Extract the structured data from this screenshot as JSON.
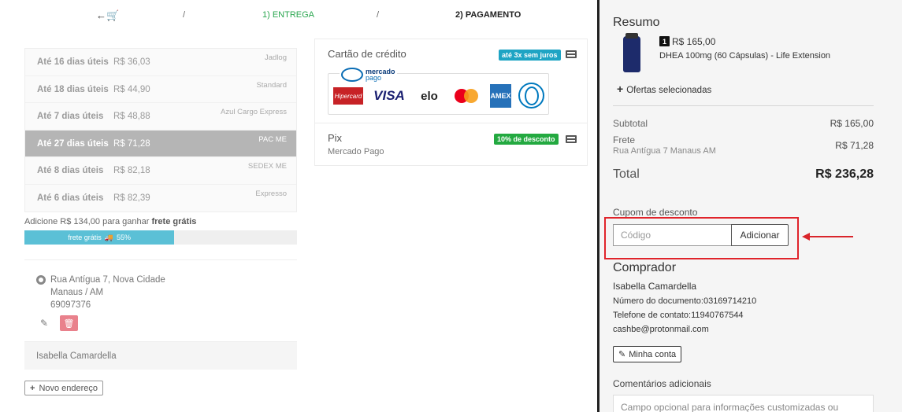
{
  "steps": {
    "back_icon": "arrow-cart-icon",
    "back_glyph": "←🛒",
    "separator": "/",
    "step1": "1) ENTREGA",
    "step2": "2) PAGAMENTO"
  },
  "shipping": {
    "options": [
      {
        "days": "Até 16 dias úteis",
        "price": "R$ 36,03",
        "carrier": "Jadlog",
        "selected": false
      },
      {
        "days": "Até 18 dias úteis",
        "price": "R$ 44,90",
        "carrier": "Standard",
        "selected": false
      },
      {
        "days": "Até 7 dias úteis",
        "price": "R$ 48,88",
        "carrier": "Azul Cargo Express",
        "selected": false
      },
      {
        "days": "Até 27 dias úteis",
        "price": "R$ 71,28",
        "carrier": "PAC ME",
        "selected": true
      },
      {
        "days": "Até 8 dias úteis",
        "price": "R$ 82,18",
        "carrier": "SEDEX ME",
        "selected": false
      },
      {
        "days": "Até 6 dias úteis",
        "price": "R$ 82,39",
        "carrier": "Expresso",
        "selected": false
      }
    ],
    "free_prefix": "Adicione R$ 134,00 para ganhar",
    "free_bold": "frete grátis",
    "progress_label": "frete grátis",
    "progress_percent_label": "55%",
    "progress_value": 0.55,
    "progress_color": "#5bc0d6"
  },
  "address": {
    "line1": "Rua Antígua 7, Nova Cidade",
    "line2": "Manaus / AM",
    "line3": "69097376",
    "name": "Isabella Camardella",
    "new_label": "Novo endereço",
    "delete_color": "#e9818c"
  },
  "payment": {
    "card_title": "Cartão de crédito",
    "card_badge": "até 3x sem juros",
    "mp_line1": "mercado",
    "mp_line2": "pago",
    "brands": {
      "hipercard": "Hipercard",
      "visa": "VISA",
      "elo": "elo",
      "amex": "AMEX"
    },
    "pix_title": "Pix",
    "pix_sub": "Mercado Pago",
    "pix_badge": "10% de desconto",
    "badge_blue": "#1ea4c4",
    "badge_green": "#23a940"
  },
  "summary": {
    "title": "Resumo",
    "qty": "1",
    "product_price": "R$ 165,00",
    "product_name": "DHEA 100mg (60 Cápsulas) - Life Extension",
    "offers": "Ofertas selecionadas",
    "subtotal_label": "Subtotal",
    "subtotal_value": "R$ 165,00",
    "frete_label": "Frete",
    "frete_address": "Rua Antígua 7 Manaus AM",
    "frete_value": "R$ 71,28",
    "total_label": "Total",
    "total_value": "R$ 236,28"
  },
  "coupon": {
    "label": "Cupom de desconto",
    "placeholder": "Código",
    "button": "Adicionar",
    "highlight_color": "#e0242b"
  },
  "buyer": {
    "title": "Comprador",
    "name": "Isabella Camardella",
    "document": "Número do documento:03169714210",
    "phone": "Telefone de contato:11940767544",
    "email": "cashbe@protonmail.com",
    "account_button": "Minha conta"
  },
  "comments": {
    "label": "Comentários adicionais",
    "placeholder": "Campo opcional para informações customizadas ou"
  }
}
